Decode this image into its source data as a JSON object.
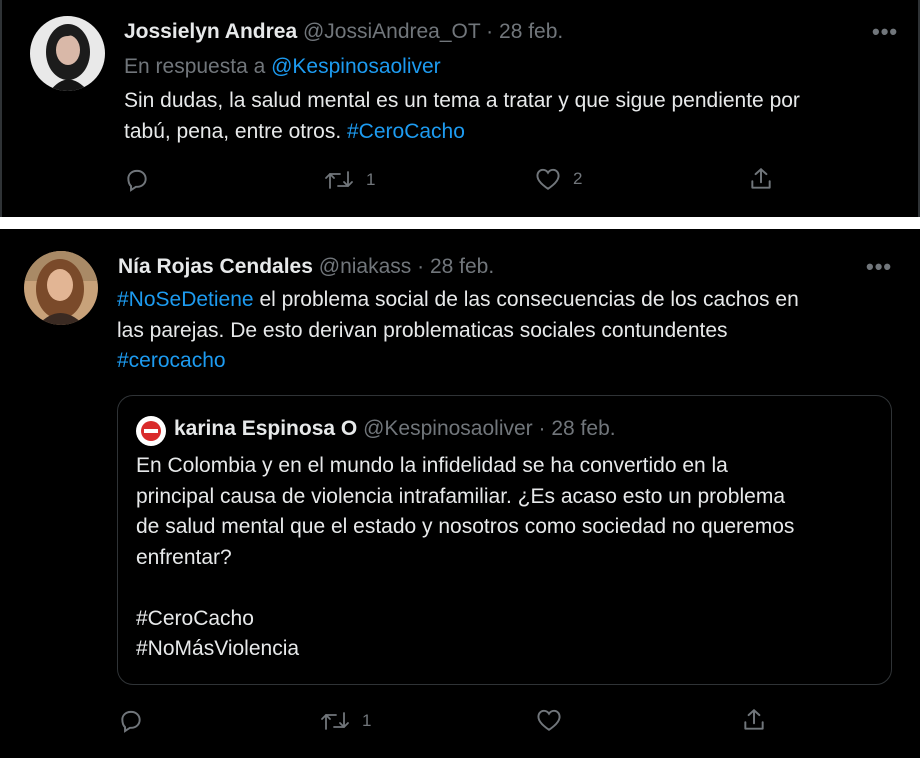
{
  "tweets": [
    {
      "author_name": "Jossielyn Andrea",
      "handle": "@JossiAndrea_OT",
      "date": "28 feb.",
      "reply_prefix": "En respuesta a",
      "reply_handle": "@Kespinosaoliver",
      "text_line1": "Sin dudas, la salud mental es un tema a tratar y que sigue pendiente por",
      "text_line2": "tabú, pena, entre otros.",
      "hashtag": "#CeroCacho",
      "retweets": "1",
      "likes": "2",
      "more": "•••"
    },
    {
      "author_name": "Nía Rojas Cendales",
      "handle": "@niakass",
      "date": "28 feb.",
      "hashtag1": "#NoSeDetiene",
      "text_line1": "el problema social de las consecuencias de los cachos en",
      "text_line2": "las parejas. De esto derivan problematicas sociales contundentes",
      "hashtag2": "#cerocacho",
      "retweets": "1",
      "more": "•••",
      "quote": {
        "author_name": "karina Espinosa O",
        "handle": "@Kespinosaoliver",
        "date": "28 feb.",
        "line1": "En Colombia y en el mundo la infidelidad se ha convertido en la",
        "line2": "principal causa de violencia intrafamiliar. ¿Es acaso esto un problema",
        "line3": "de salud mental que el estado y nosotros como sociedad no queremos",
        "line4": "enfrentar?",
        "hashtag1": "#CeroCacho",
        "hashtag2": "#NoMásViolencia"
      }
    }
  ],
  "separator": "·",
  "icons": [
    "reply-icon",
    "retweet-icon",
    "like-icon",
    "share-icon",
    "more-icon"
  ],
  "colors": {
    "background": "#000000",
    "text": "#e7e9ea",
    "muted": "#71767b",
    "link": "#1d9bf0",
    "border": "#2f3336"
  }
}
